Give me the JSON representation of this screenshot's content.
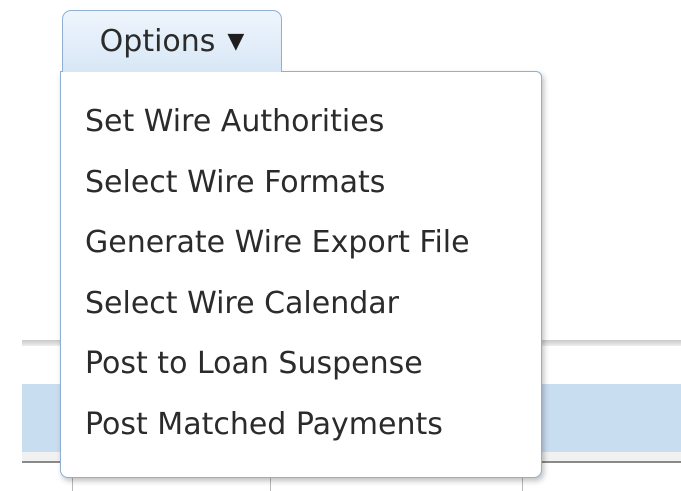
{
  "options_button": {
    "label": "Options",
    "caret": "▼"
  },
  "menu": {
    "items": [
      {
        "label": "Set Wire Authorities"
      },
      {
        "label": "Select Wire Formats"
      },
      {
        "label": "Generate Wire Export File"
      },
      {
        "label": "Select Wire Calendar"
      },
      {
        "label": "Post to Loan Suspense"
      },
      {
        "label": "Post Matched Payments"
      }
    ]
  },
  "colors": {
    "button_gradient_top": "#eef5fc",
    "button_gradient_bottom": "#d8e7f6",
    "border": "#8fb0d3",
    "background_band": "#c9ddf1",
    "text": "#2b2b2b"
  }
}
